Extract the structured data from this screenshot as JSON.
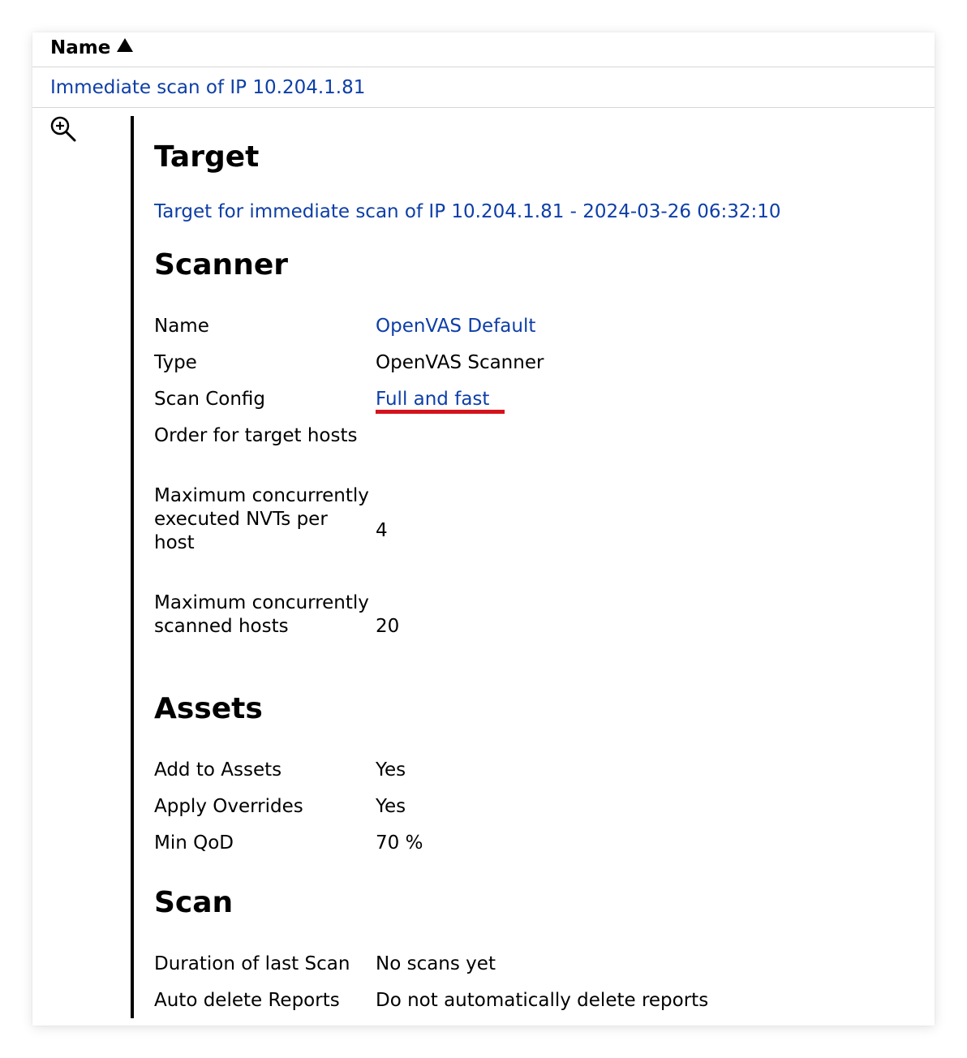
{
  "table": {
    "column_header": "Name",
    "sort_icon": "sort-ascending-triangle",
    "row_name": "Immediate scan of IP 10.204.1.81",
    "details_icon": "zoom-in-icon"
  },
  "target": {
    "heading": "Target",
    "link": "Target for immediate scan of IP 10.204.1.81 - 2024-03-26 06:32:10"
  },
  "scanner": {
    "heading": "Scanner",
    "name_label": "Name",
    "name_value": "OpenVAS Default",
    "type_label": "Type",
    "type_value": "OpenVAS Scanner",
    "config_label": "Scan Config",
    "config_value": "Full and fast",
    "order_label": "Order for target hosts",
    "order_value": "",
    "max_nvts_label": "Maximum concurrently executed NVTs per host",
    "max_nvts_value": "4",
    "max_hosts_label": "Maximum concurrently scanned hosts",
    "max_hosts_value": "20"
  },
  "assets": {
    "heading": "Assets",
    "add_label": "Add to Assets",
    "add_value": "Yes",
    "overrides_label": "Apply Overrides",
    "overrides_value": "Yes",
    "qod_label": "Min QoD",
    "qod_value": "70 %"
  },
  "scan": {
    "heading": "Scan",
    "duration_label": "Duration of last Scan",
    "duration_value": "No scans yet",
    "autodelete_label": "Auto delete Reports",
    "autodelete_value": "Do not automatically delete reports"
  },
  "colors": {
    "link": "#0d3ea8",
    "annotation_underline": "#d4121c"
  }
}
